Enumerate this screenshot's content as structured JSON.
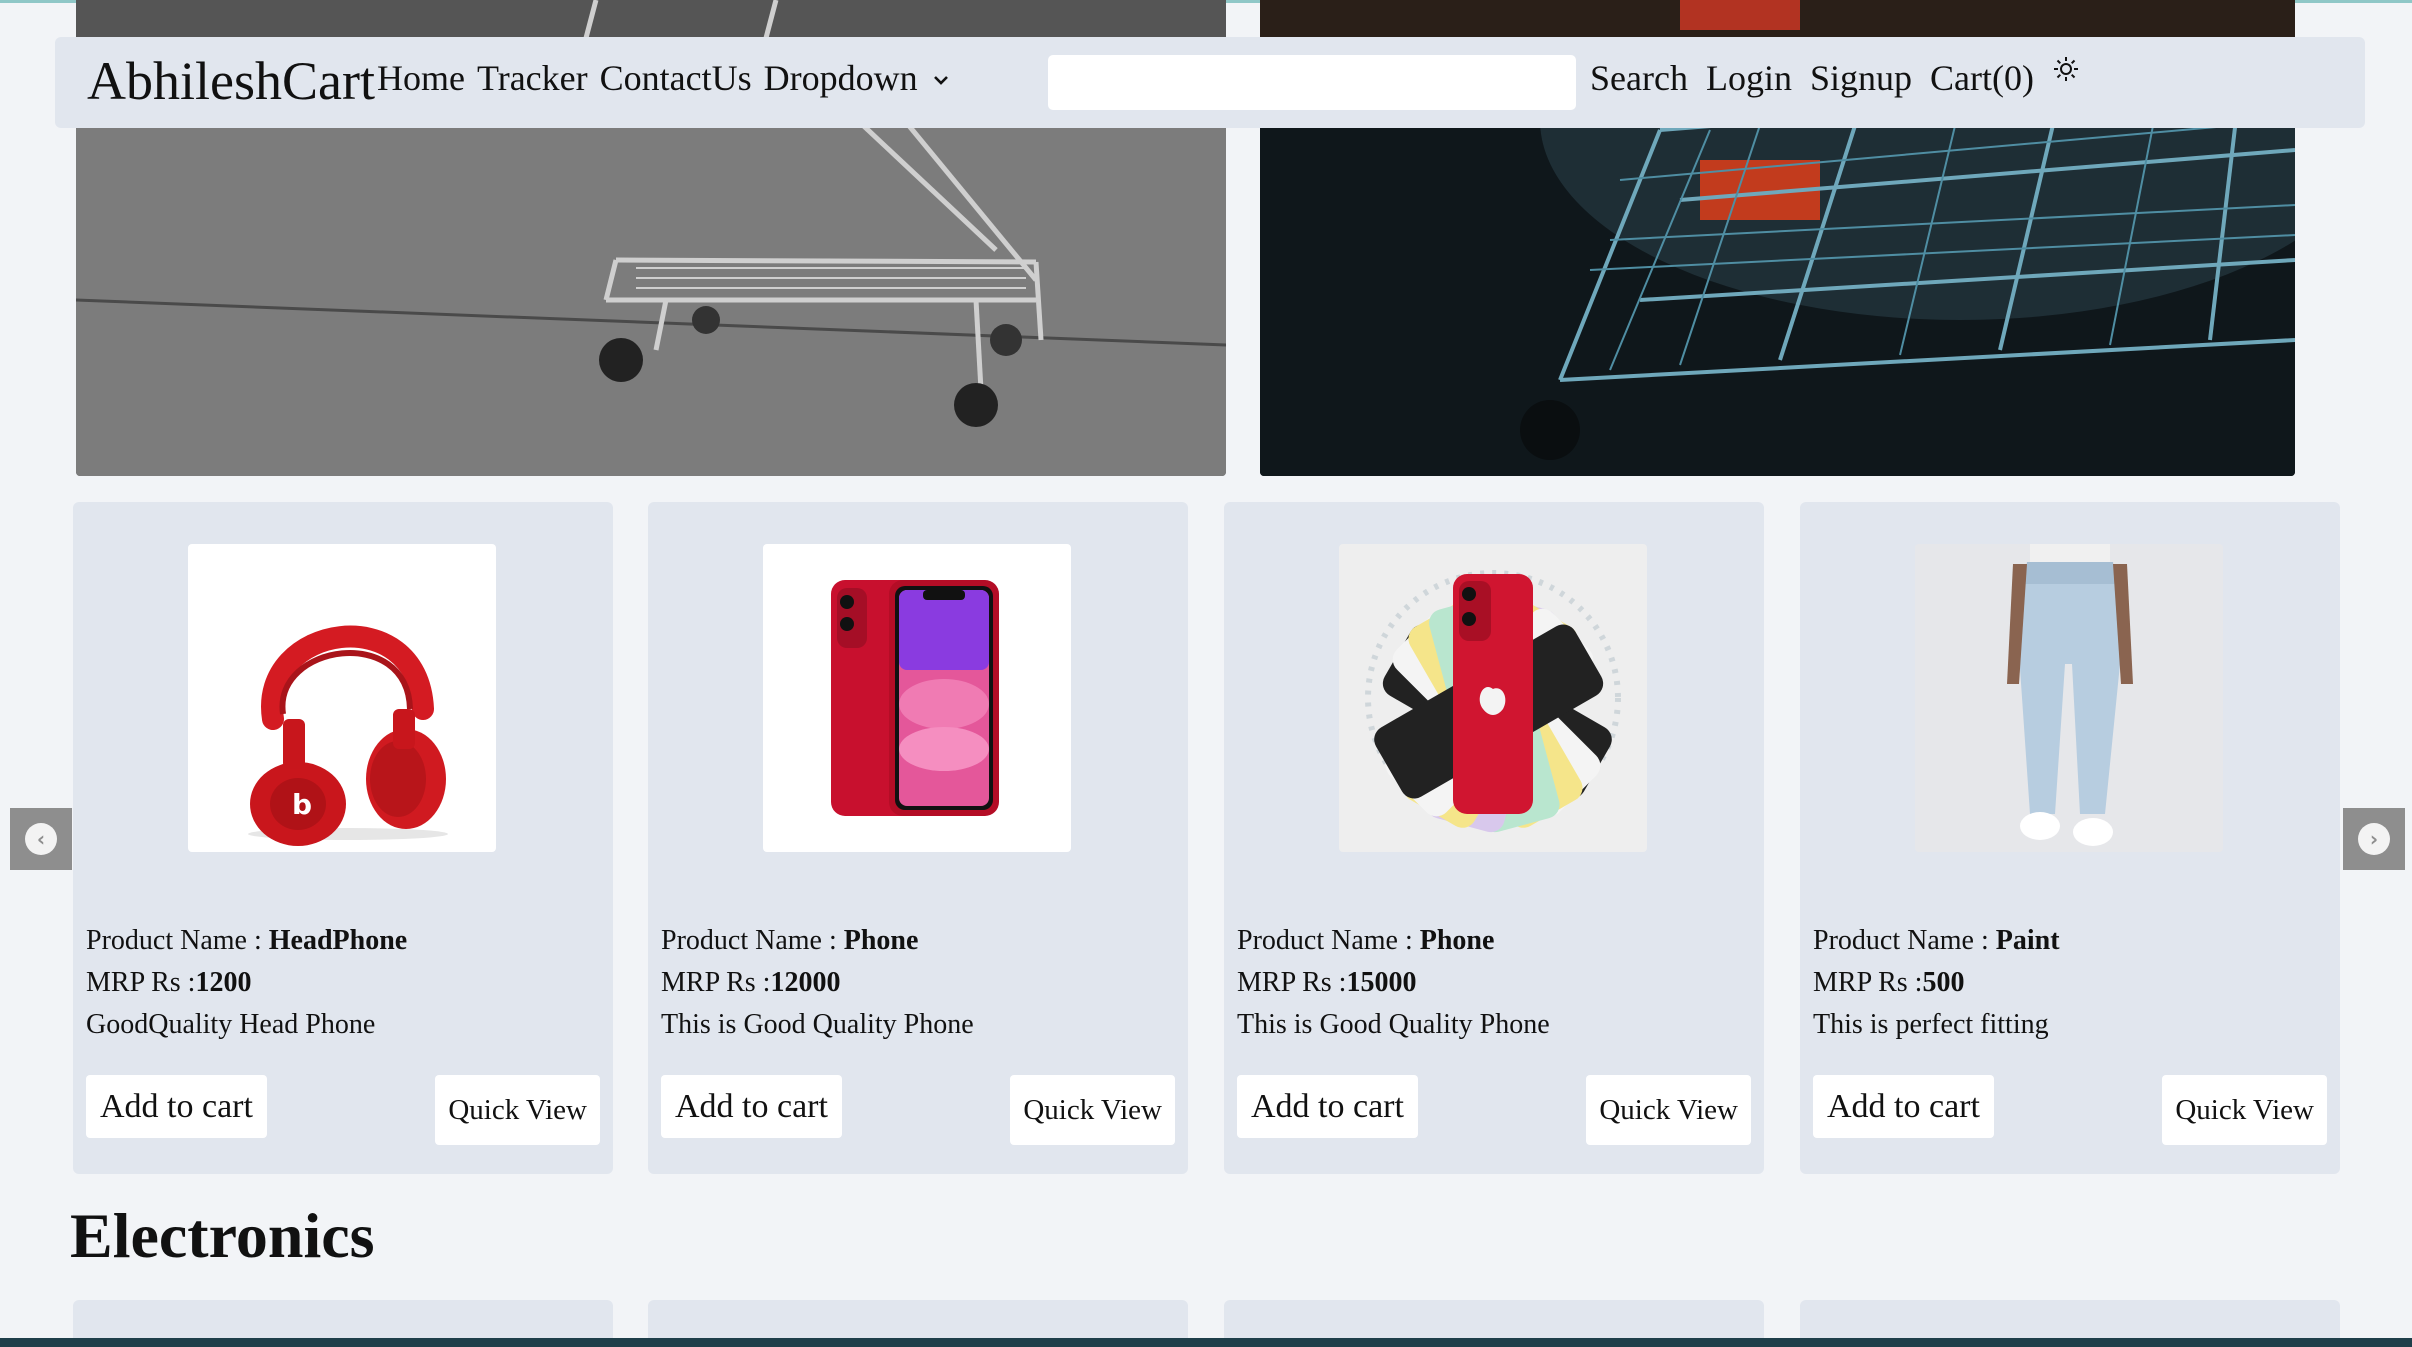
{
  "navbar": {
    "brand": "AbhileshCart",
    "links": [
      "Home",
      "Tracker",
      "ContactUs"
    ],
    "dropdown_label": "Dropdown",
    "search_placeholder": "",
    "search_label": "Search",
    "login_label": "Login",
    "signup_label": "Signup",
    "cart_label": "Cart(0)",
    "theme_icon": "sun-icon"
  },
  "products": [
    {
      "name_label": "Product Name : ",
      "name": "HeadPhone",
      "price_label": "MRP Rs :",
      "price": "1200",
      "description": "GoodQuality Head Phone",
      "add_to_cart": "Add to cart",
      "quick_view": "Quick View",
      "image": "red-headphones"
    },
    {
      "name_label": "Product Name : ",
      "name": "Phone",
      "price_label": "MRP Rs :",
      "price": "12000",
      "description": "This is Good Quality Phone",
      "add_to_cart": "Add to cart",
      "quick_view": "Quick View",
      "image": "red-phone-front"
    },
    {
      "name_label": "Product Name : ",
      "name": "Phone",
      "price_label": "MRP Rs :",
      "price": "15000",
      "description": "This is Good Quality Phone",
      "add_to_cart": "Add to cart",
      "quick_view": "Quick View",
      "image": "phone-color-fan"
    },
    {
      "name_label": "Product Name : ",
      "name": "Paint",
      "price_label": "MRP Rs :",
      "price": "500",
      "description": "This is perfect fitting",
      "add_to_cart": "Add to cart",
      "quick_view": "Quick View",
      "image": "jeans"
    }
  ],
  "carousel": {
    "prev_icon": "chevron-left-icon",
    "next_icon": "chevron-right-icon"
  },
  "sections": {
    "electronics_title": "Electronics"
  },
  "colors": {
    "navbar_bg": "#e1e6ee",
    "card_bg": "#e1e6ee",
    "page_bg": "#f2f4f7",
    "bottom_bar": "#1f3f4a"
  }
}
